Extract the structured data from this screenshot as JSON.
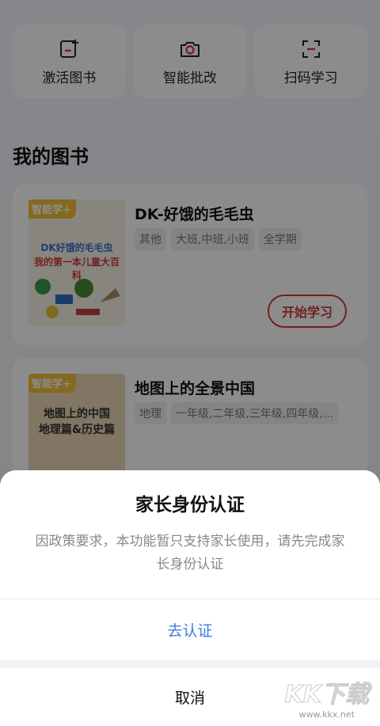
{
  "actions": [
    {
      "label": "激活图书",
      "icon": "activate-book-icon"
    },
    {
      "label": "智能批改",
      "icon": "camera-icon"
    },
    {
      "label": "扫码学习",
      "icon": "scan-icon"
    }
  ],
  "section_title": "我的图书",
  "books": [
    {
      "title": "DK-好饿的毛毛虫",
      "tags": [
        "其他",
        "大班,中班,小班",
        "全学期"
      ],
      "cover_badge": "智能学+",
      "cover_line1": "DK好饿的毛毛虫",
      "cover_line2": "我的第一本儿童大百科",
      "button": "开始学习"
    },
    {
      "title": "地图上的全景中国",
      "tags": [
        "地理",
        "一年级,二年级,三年级,四年级,..."
      ],
      "cover_badge": "智能学+",
      "cover_line1": "地图上的中国",
      "cover_line2": "地理篇&历史篇"
    }
  ],
  "dialog": {
    "title": "家长身份认证",
    "message": "因政策要求，本功能暂只支持家长使用，请先完成家长身份认证",
    "confirm": "去认证",
    "cancel": "取消"
  },
  "watermark": {
    "logo": "KK下载",
    "url": "www.kkx.net"
  },
  "colors": {
    "accent_red": "#d23a3a",
    "link_blue": "#3c7ce0"
  }
}
